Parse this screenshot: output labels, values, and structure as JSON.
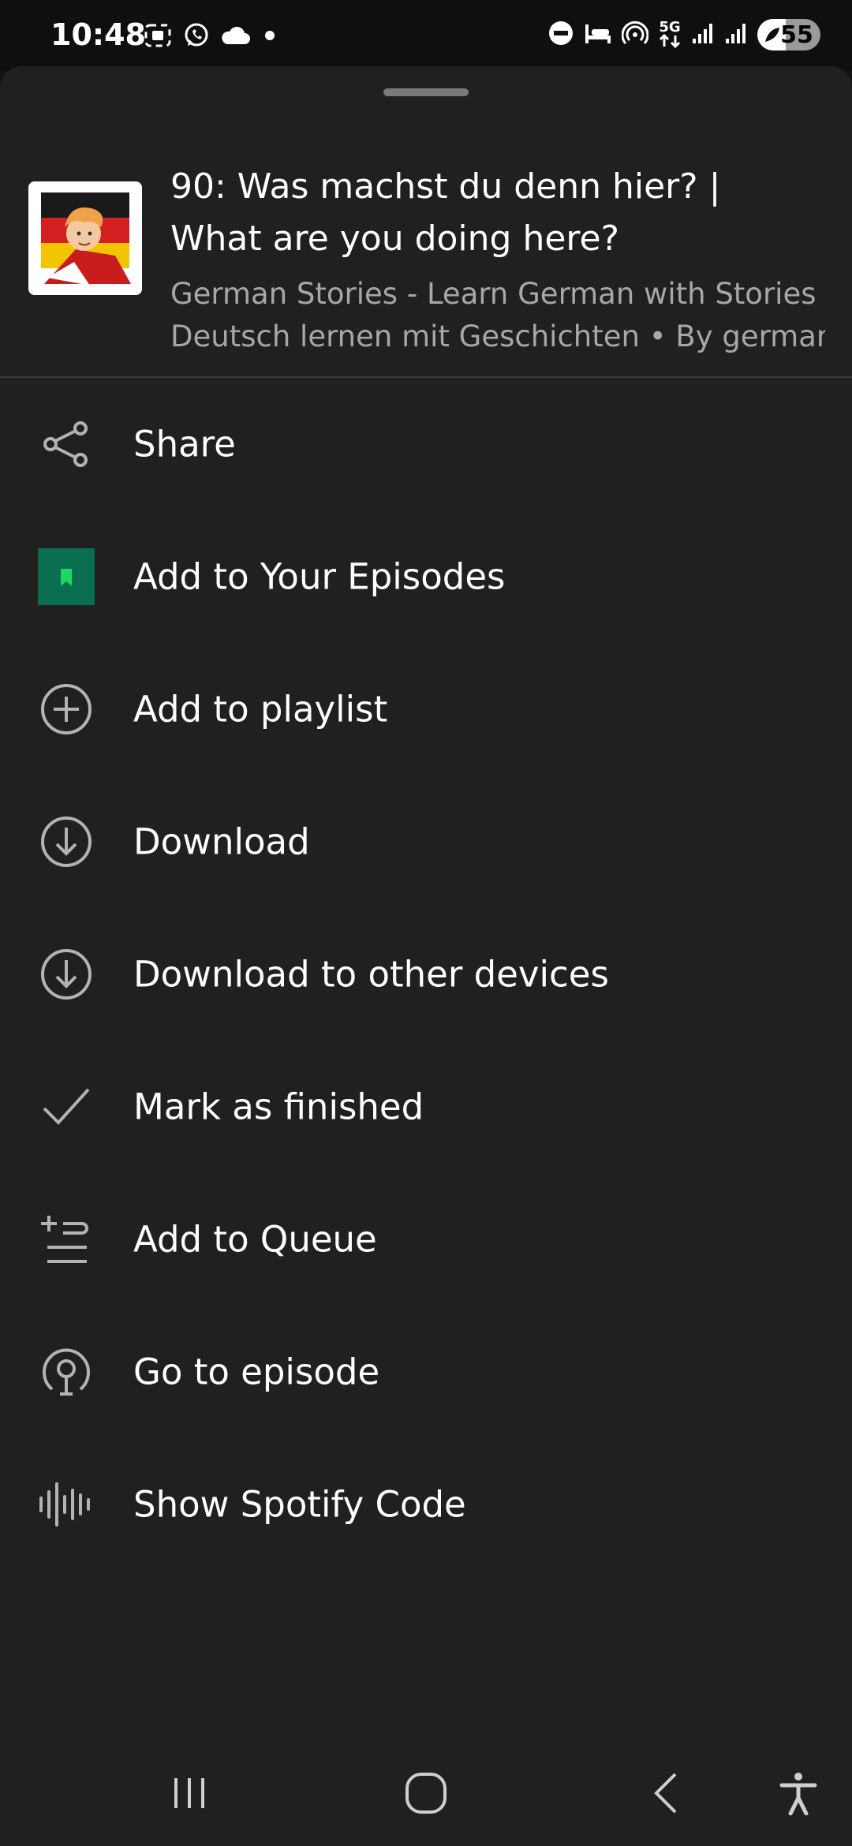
{
  "status_bar": {
    "time": "10:48",
    "network": "5G",
    "battery": "55"
  },
  "episode": {
    "title": "90: Was machst du denn hier? | What are you doing here?",
    "subtitle_line1": "German Stories - Learn German with Stories |",
    "subtitle_line2": "Deutsch lernen mit Geschichten • By german-..."
  },
  "menu": {
    "items": [
      {
        "label": "Share",
        "icon": "share-icon"
      },
      {
        "label": "Add to Your Episodes",
        "icon": "bookmark-icon"
      },
      {
        "label": "Add to playlist",
        "icon": "plus-circle-icon"
      },
      {
        "label": "Download",
        "icon": "download-icon"
      },
      {
        "label": "Download to other devices",
        "icon": "download-icon"
      },
      {
        "label": "Mark as finished",
        "icon": "check-icon"
      },
      {
        "label": "Add to Queue",
        "icon": "add-queue-icon"
      },
      {
        "label": "Go to episode",
        "icon": "podcast-icon"
      },
      {
        "label": "Show Spotify Code",
        "icon": "spotify-code-icon"
      }
    ]
  },
  "nav_bar": {
    "buttons": [
      "recent-apps-icon",
      "home-icon",
      "back-icon",
      "accessibility-icon"
    ]
  },
  "colors": {
    "sheet_background": "#202020",
    "text_primary": "#ffffff",
    "text_secondary": "#a7a7a7",
    "accent_green": "#1ed760",
    "bookmark_tile": "#0a6e50"
  }
}
